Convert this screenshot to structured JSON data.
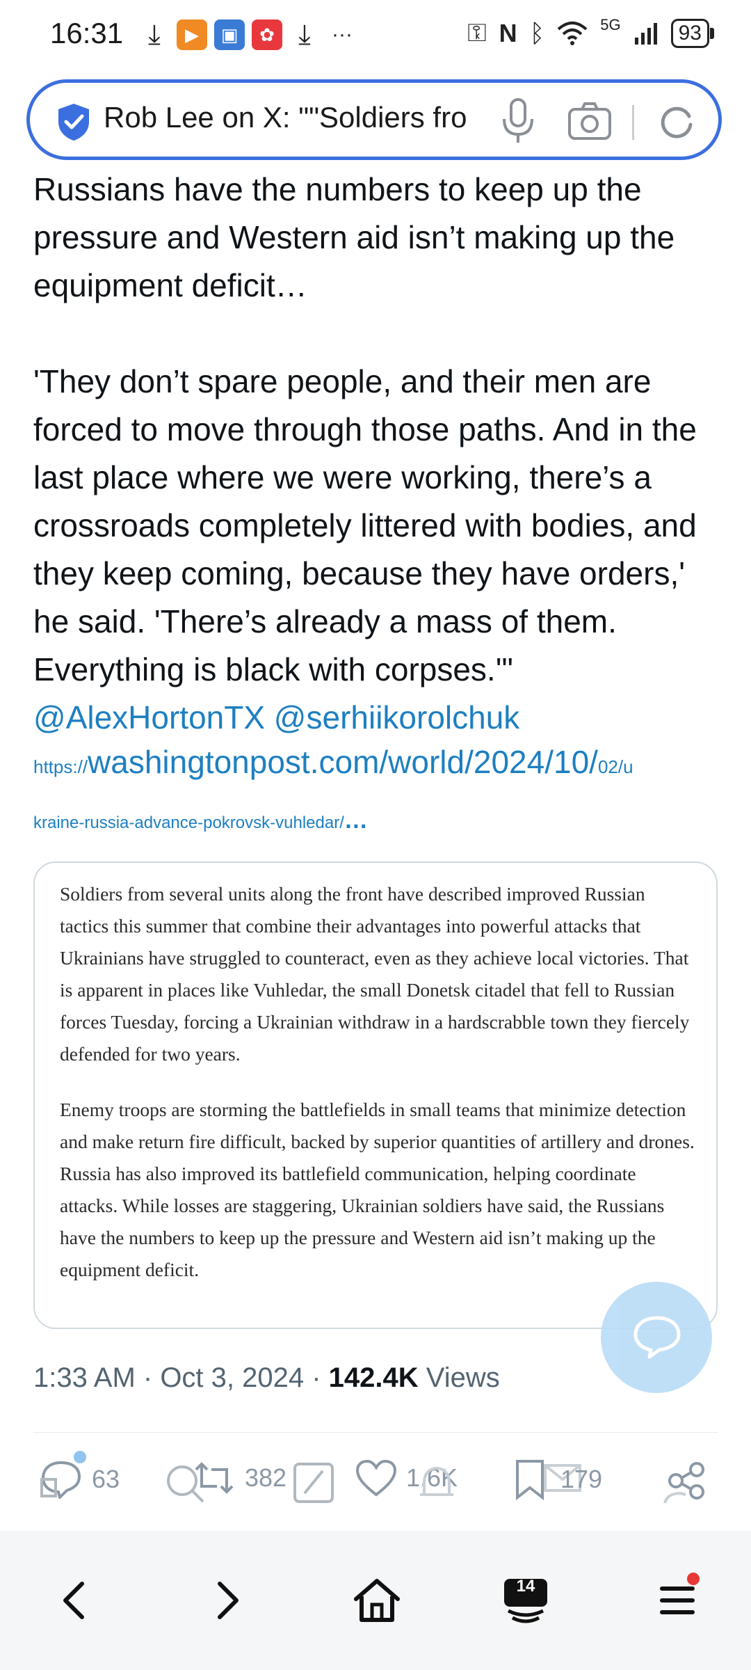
{
  "status_bar": {
    "time": "16:31",
    "network": "5G",
    "battery": "93",
    "more": "···"
  },
  "address_bar": {
    "title": "Rob Lee on X: \"\"Soldiers fro"
  },
  "tweet": {
    "paragraph1": "Russians have the numbers to keep up the pressure and Western aid isn’t making up the equipment deficit…",
    "paragraph2": "'They don’t spare people, and their men are forced to move through those paths. And in the last place where we were working, there’s a crossroads completely littered with bodies, and they keep coming, because they have orders,' he said. 'There’s already a mass of them. Everything is black with corpses.'\"",
    "mentions": "@AlexHortonTX @serhiikorolchuk",
    "link_prefix": "https://",
    "link_main": "washingtonpost.com/world/2024/10/",
    "link_suffix": "02/u",
    "link_line2": "kraine-russia-advance-pokrovsk-vuhledar/",
    "link_ellipsis": "…"
  },
  "quote_card": {
    "paragraph1": "Soldiers from several units along the front have described improved Russian tactics this summer that combine their advantages into powerful attacks that Ukrainians have struggled to counteract, even as they achieve local victories. That is apparent in places like Vuhledar, the small Donetsk citadel that fell to Russian forces Tuesday, forcing a Ukrainian withdraw in a hardscrabble town they fiercely defended for two years.",
    "paragraph2": "Enemy troops are storming the battlefields in small teams that minimize detection and make return fire difficult, backed by superior quantities of artillery and drones. Russia has also improved its battlefield communication, helping coordinate attacks. While losses are staggering, Ukrainian soldiers have said, the Russians have the numbers to keep up the pressure and Western aid isn’t making up the equipment deficit."
  },
  "meta": {
    "time": "1:33 AM",
    "sep1": " · ",
    "date": "Oct 3, 2024",
    "sep2": " · ",
    "views_count": "142.4K",
    "views_label": " Views"
  },
  "actions": {
    "replies": "63",
    "reposts": "382",
    "likes": "1.6K",
    "bookmarks": "179"
  },
  "bottom_nav": {
    "tabs_count": "14"
  },
  "colors": {
    "accent": "#3b6fe0",
    "link": "#1d7fc1",
    "muted": "#536471"
  }
}
